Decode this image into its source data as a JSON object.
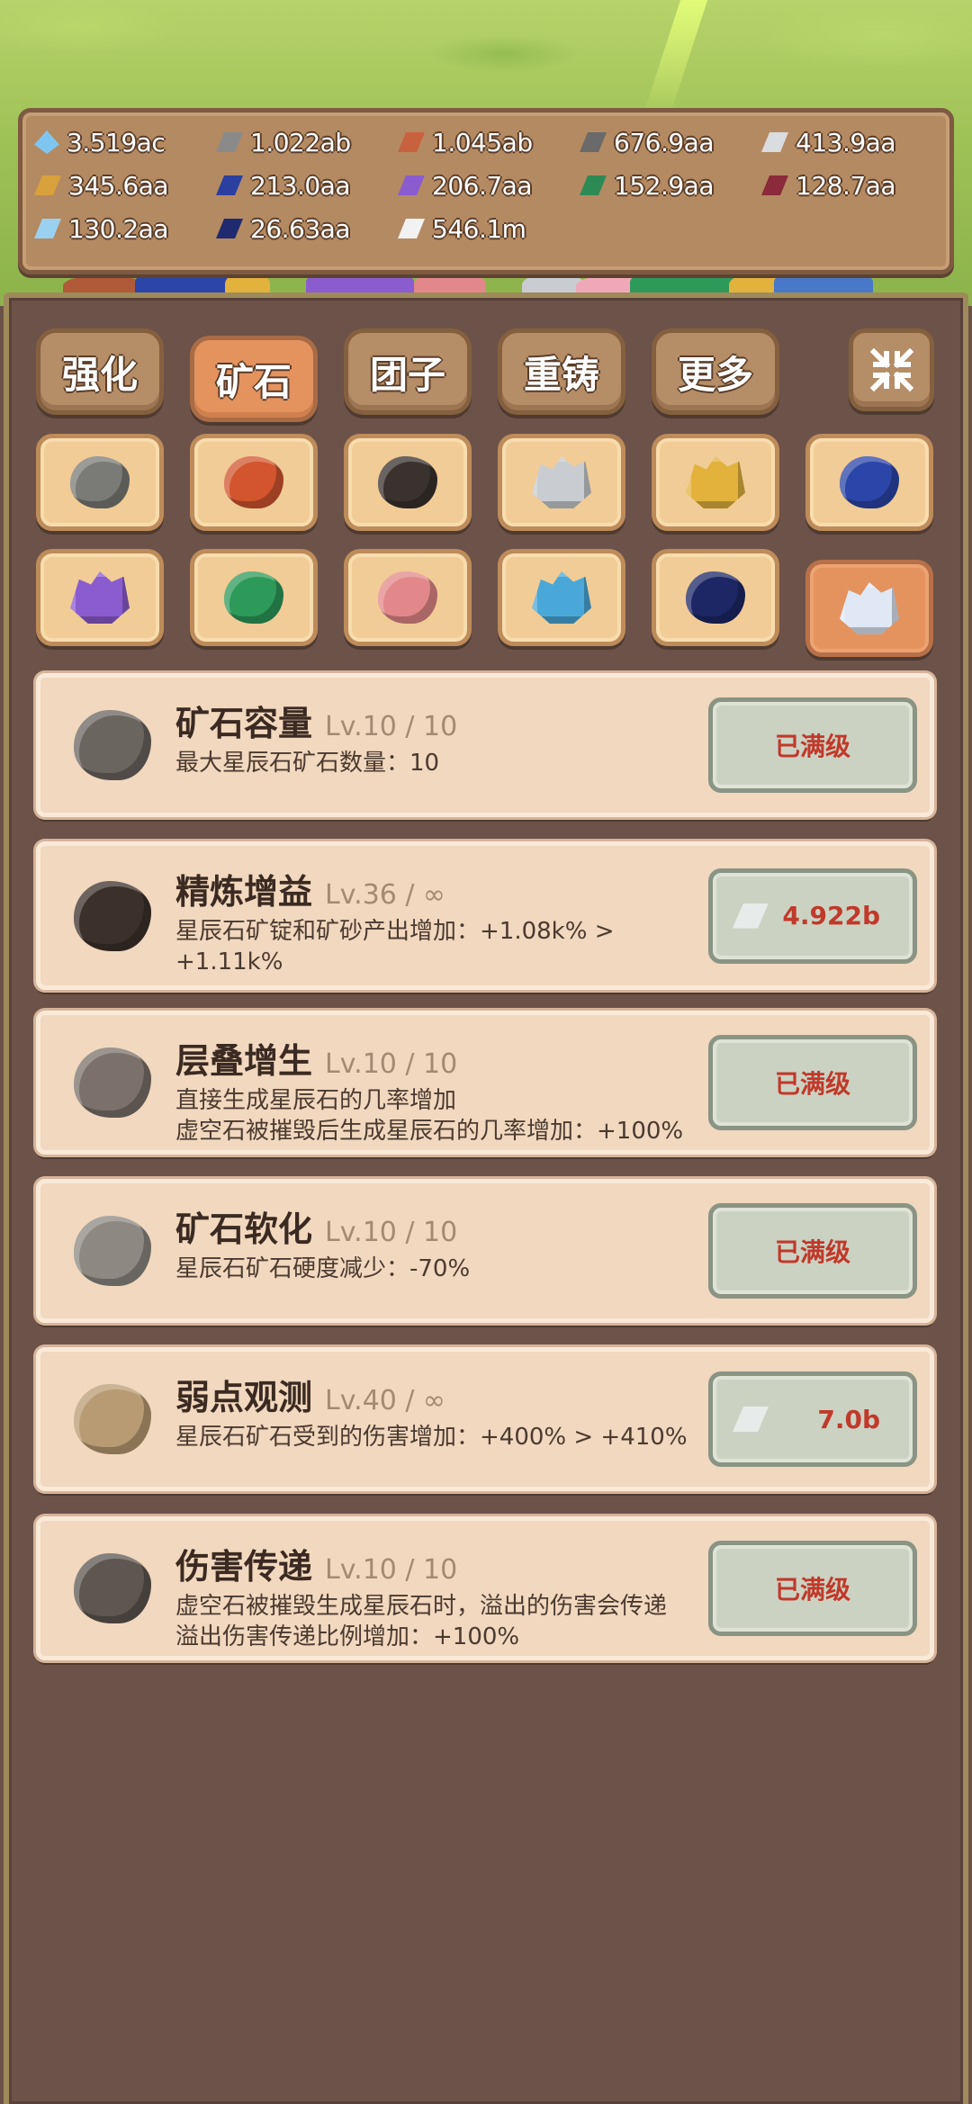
{
  "resources": [
    {
      "value": "3.519ac",
      "color": "#7ec6f0",
      "shape": "diamond-icon"
    },
    {
      "value": "1.022ab",
      "color": "#8a8a8a",
      "shape": "ingot-icon"
    },
    {
      "value": "1.045ab",
      "color": "#c8623e",
      "shape": "ingot-icon"
    },
    {
      "value": "676.9aa",
      "color": "#6a6a6a",
      "shape": "ingot-icon"
    },
    {
      "value": "413.9aa",
      "color": "#d9dde0",
      "shape": "ingot-icon"
    },
    {
      "value": "345.6aa",
      "color": "#d9a13c",
      "shape": "ingot-icon"
    },
    {
      "value": "213.0aa",
      "color": "#2a3fa0",
      "shape": "ingot-icon"
    },
    {
      "value": "206.7aa",
      "color": "#8b5ccf",
      "shape": "ingot-icon"
    },
    {
      "value": "152.9aa",
      "color": "#2e8a55",
      "shape": "ingot-icon"
    },
    {
      "value": "128.7aa",
      "color": "#8a2a3a",
      "shape": "ingot-icon"
    },
    {
      "value": "130.2aa",
      "color": "#9ad0f0",
      "shape": "ingot-icon"
    },
    {
      "value": "26.63aa",
      "color": "#1f2a70",
      "shape": "ingot-icon"
    },
    {
      "value": "546.1m",
      "color": "#f2f2f2",
      "shape": "ingot-icon"
    }
  ],
  "tabs": [
    {
      "label": "强化",
      "active": false
    },
    {
      "label": "矿石",
      "active": true
    },
    {
      "label": "团子",
      "active": false
    },
    {
      "label": "重铸",
      "active": false
    },
    {
      "label": "更多",
      "active": false
    }
  ],
  "ores": [
    {
      "name": "stone-ore-icon",
      "color": "#7a7a76"
    },
    {
      "name": "copper-ore-icon",
      "color": "#d2552e"
    },
    {
      "name": "coal-ore-icon",
      "color": "#3a322e"
    },
    {
      "name": "silver-ore-icon",
      "color": "#c9cdd1"
    },
    {
      "name": "gold-ore-icon",
      "color": "#e2b23c"
    },
    {
      "name": "sapphire-ore-icon",
      "color": "#2b45a8"
    },
    {
      "name": "amethyst-ore-icon",
      "color": "#8b5ccf"
    },
    {
      "name": "emerald-ore-icon",
      "color": "#2e9a5a"
    },
    {
      "name": "rose-quartz-ore-icon",
      "color": "#e3888a"
    },
    {
      "name": "aquamarine-ore-icon",
      "color": "#4aa8d8"
    },
    {
      "name": "dark-sapphire-ore-icon",
      "color": "#1d2766"
    },
    {
      "name": "stardust-ore-icon",
      "color": "#dfe8f4",
      "active": true
    }
  ],
  "upgrades": [
    {
      "title": "矿石容量",
      "level": "Lv.10 / 10",
      "desc": [
        "最大星辰石矿石数量：10"
      ],
      "button": "已满级",
      "maxed": true
    },
    {
      "title": "精炼增益",
      "level": "Lv.36 / ∞",
      "desc": [
        "星辰石矿锭和矿砂产出增加：+1.08k% >",
        "+1.11k%"
      ],
      "button": "4.922b",
      "maxed": false
    },
    {
      "title": "层叠增生",
      "level": "Lv.10 / 10",
      "desc": [
        "直接生成星辰石的几率增加",
        "虚空石被摧毁后生成星辰石的几率增加：+100%"
      ],
      "button": "已满级",
      "maxed": true
    },
    {
      "title": "矿石软化",
      "level": "Lv.10 / 10",
      "desc": [
        "星辰石矿石硬度减少：-70%"
      ],
      "button": "已满级",
      "maxed": true
    },
    {
      "title": "弱点观测",
      "level": "Lv.40 / ∞",
      "desc": [
        "星辰石矿石受到的伤害增加：+400% > +410%"
      ],
      "button": "7.0b",
      "maxed": false
    },
    {
      "title": "伤害传递",
      "level": "Lv.10 / 10",
      "desc": [
        "虚空石被摧毁生成星辰石时，溢出的伤害会传递",
        "溢出伤害传递比例增加：+100%"
      ],
      "button": "已满级",
      "maxed": true
    }
  ]
}
